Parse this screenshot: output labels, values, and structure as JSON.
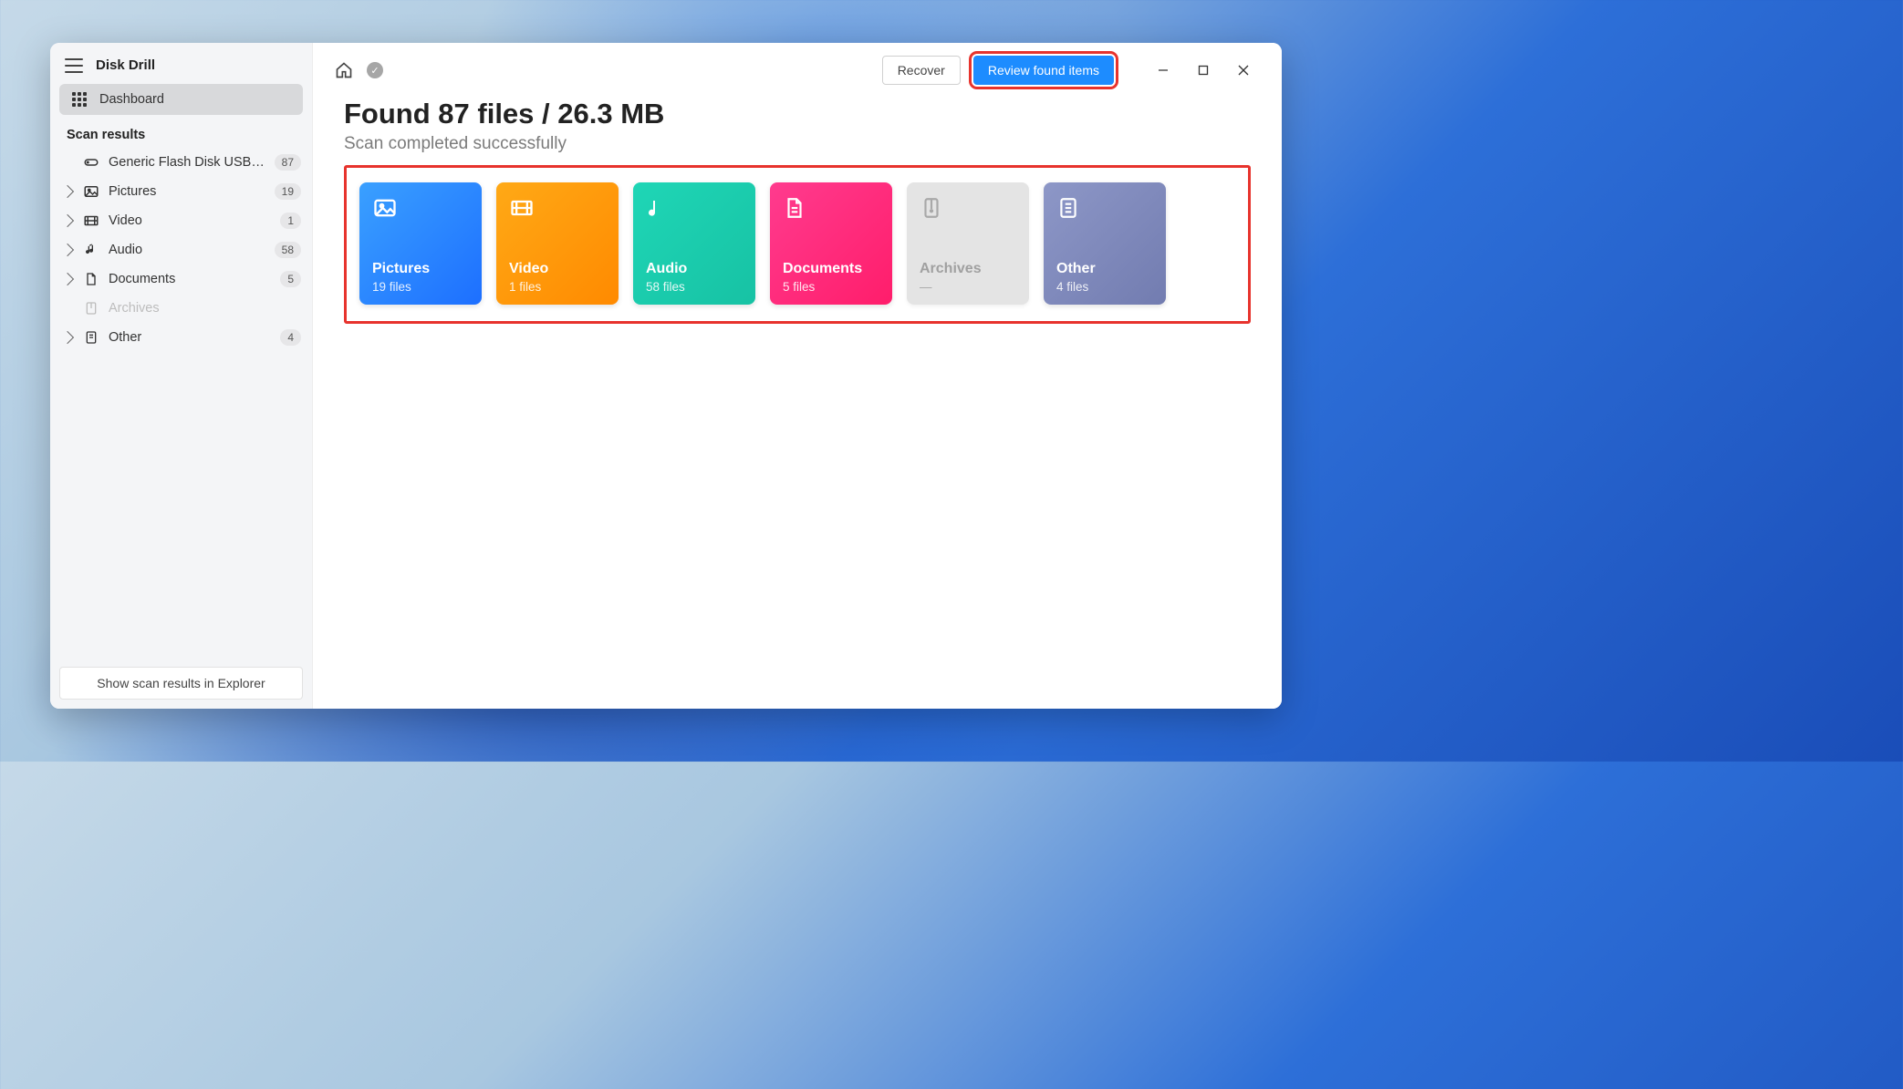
{
  "app": {
    "title": "Disk Drill"
  },
  "sidebar": {
    "dashboard_label": "Dashboard",
    "scan_results_header": "Scan results",
    "device": {
      "label": "Generic Flash Disk USB D…",
      "count": "87"
    },
    "items": [
      {
        "label": "Pictures",
        "count": "19"
      },
      {
        "label": "Video",
        "count": "1"
      },
      {
        "label": "Audio",
        "count": "58"
      },
      {
        "label": "Documents",
        "count": "5"
      },
      {
        "label": "Archives",
        "count": ""
      },
      {
        "label": "Other",
        "count": "4"
      }
    ],
    "explorer_button": "Show scan results in Explorer"
  },
  "toolbar": {
    "recover_label": "Recover",
    "review_label": "Review found items"
  },
  "main": {
    "headline": "Found 87 files / 26.3 MB",
    "subhead": "Scan completed successfully"
  },
  "tiles": [
    {
      "title": "Pictures",
      "sub": "19 files"
    },
    {
      "title": "Video",
      "sub": "1 files"
    },
    {
      "title": "Audio",
      "sub": "58 files"
    },
    {
      "title": "Documents",
      "sub": "5 files"
    },
    {
      "title": "Archives",
      "sub": "—"
    },
    {
      "title": "Other",
      "sub": "4 files"
    }
  ]
}
